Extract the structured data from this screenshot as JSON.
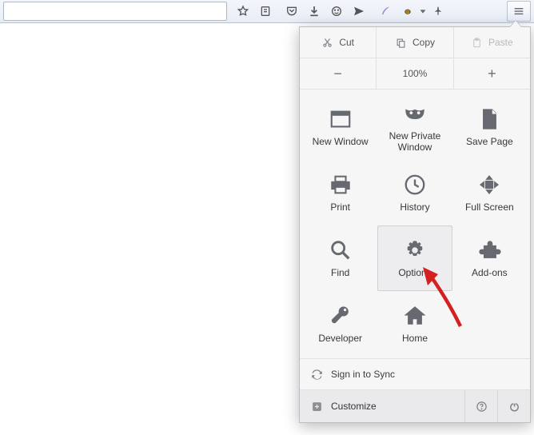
{
  "toolbar": {
    "hamburger": true
  },
  "edit": {
    "cut": "Cut",
    "copy": "Copy",
    "paste": "Paste"
  },
  "zoom": {
    "value": "100%"
  },
  "grid": {
    "newWindow": "New Window",
    "newPrivate": "New Private Window",
    "savePage": "Save Page",
    "print": "Print",
    "history": "History",
    "fullScreen": "Full Screen",
    "find": "Find",
    "options": "Options",
    "addons": "Add-ons",
    "developer": "Developer",
    "home": "Home"
  },
  "footer": {
    "sync": "Sign in to Sync",
    "customize": "Customize"
  }
}
